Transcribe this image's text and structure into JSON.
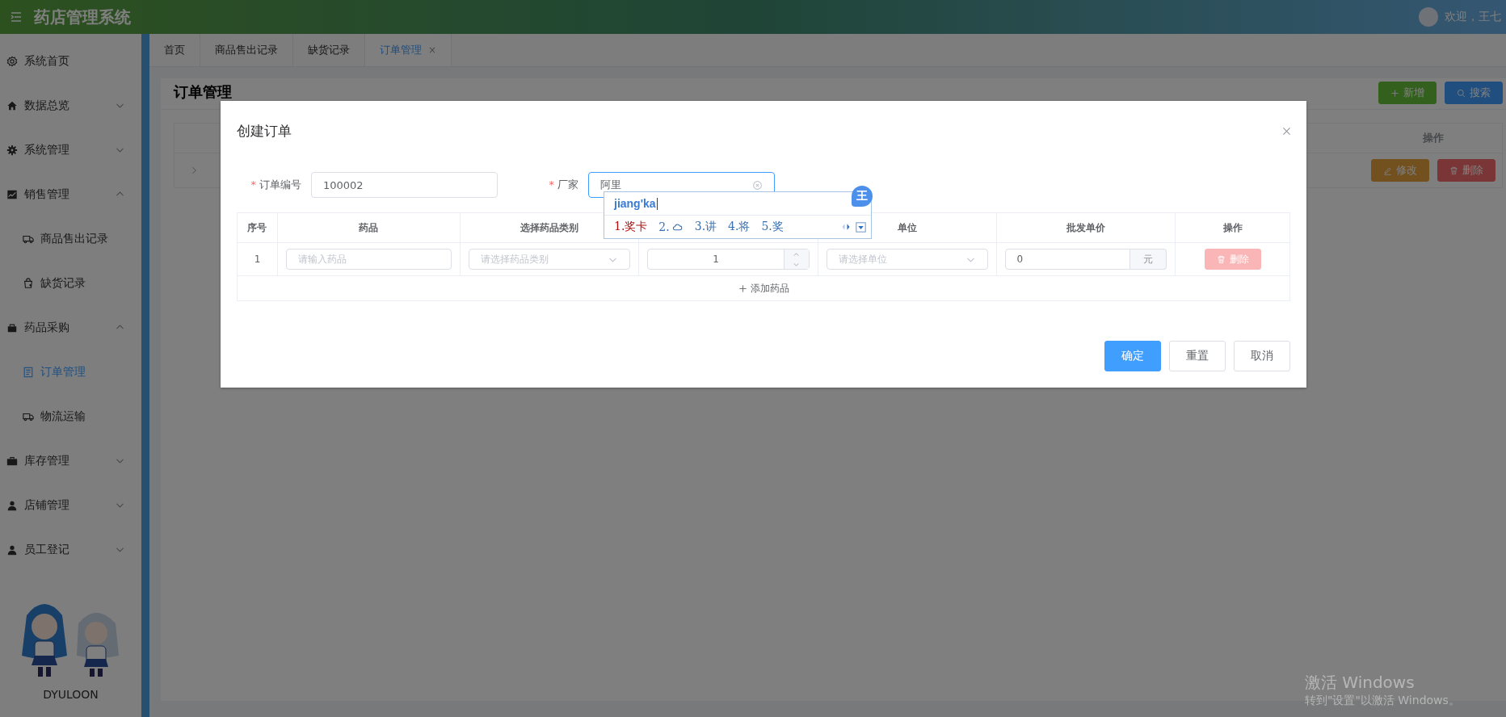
{
  "header": {
    "title": "药店管理系统",
    "greeting": "欢迎，王七"
  },
  "sidebar": {
    "items": [
      {
        "label": "系统首页",
        "selected": false
      },
      {
        "label": "数据总览",
        "expanded": false,
        "selected": false
      },
      {
        "label": "系统管理",
        "expanded": false,
        "selected": false
      },
      {
        "label": "销售管理",
        "expanded": true,
        "selected": false,
        "children": [
          {
            "label": "商品售出记录",
            "selected": false
          },
          {
            "label": "缺货记录",
            "selected": false
          }
        ]
      },
      {
        "label": "药品采购",
        "expanded": true,
        "selected": false,
        "children": [
          {
            "label": "订单管理",
            "selected": true
          },
          {
            "label": "物流运输",
            "selected": false
          }
        ]
      },
      {
        "label": "库存管理",
        "expanded": false,
        "selected": false
      },
      {
        "label": "店铺管理",
        "expanded": false,
        "selected": false
      },
      {
        "label": "员工登记",
        "expanded": false,
        "selected": false
      }
    ],
    "footer_name": "DYULOON"
  },
  "tabs": [
    {
      "label": "首页",
      "selected": false
    },
    {
      "label": "商品售出记录",
      "selected": false
    },
    {
      "label": "缺货记录",
      "selected": false
    },
    {
      "label": "订单管理",
      "selected": true,
      "close": "×"
    }
  ],
  "page": {
    "title": "订单管理",
    "buttons": [
      {
        "label": "新增",
        "kind": "success"
      },
      {
        "label": "搜索",
        "kind": "primary"
      }
    ],
    "table": {
      "action_header": "操作",
      "row_buttons": [
        {
          "label": "修改",
          "kind": "warning"
        },
        {
          "label": "删除",
          "kind": "danger"
        }
      ]
    }
  },
  "dialog": {
    "title": "创建订单",
    "required_mark": "*",
    "fields": [
      {
        "label": "订单编号",
        "required": true,
        "value": "100002",
        "focused": false
      },
      {
        "label": "厂家",
        "required": true,
        "value": "阿里",
        "focused": true
      }
    ],
    "table": {
      "columns": [
        "序号",
        "药品",
        "选择药品类别",
        "",
        "单位",
        "批发单价",
        "操作"
      ],
      "rows": [
        {
          "index": "1",
          "medicine_placeholder": "请输入药品",
          "category_placeholder": "请选择药品类别",
          "quantity": "1",
          "unit_placeholder": "请选择单位",
          "price": "0",
          "currency": "元",
          "delete_label": "删除",
          "delete_disabled": true
        }
      ],
      "add_label": "添加药品"
    },
    "buttons": [
      {
        "label": "确定",
        "kind": "primary"
      },
      {
        "label": "重置",
        "kind": "default"
      },
      {
        "label": "取消",
        "kind": "default"
      }
    ]
  },
  "ime": {
    "composition": "jiang'ka",
    "badge": "王",
    "candidates": [
      {
        "label": "1.奖卡",
        "kind": "text",
        "selected": true
      },
      {
        "label": "2.",
        "kind": "cloud",
        "selected": false
      },
      {
        "label": "3.讲",
        "kind": "text",
        "selected": false
      },
      {
        "label": "4.将",
        "kind": "text",
        "selected": false
      },
      {
        "label": "5.奖",
        "kind": "text",
        "selected": false
      }
    ]
  },
  "os_notice": {
    "title": "激活 Windows",
    "subtitle": "转到\"设置\"以激活 Windows。"
  }
}
